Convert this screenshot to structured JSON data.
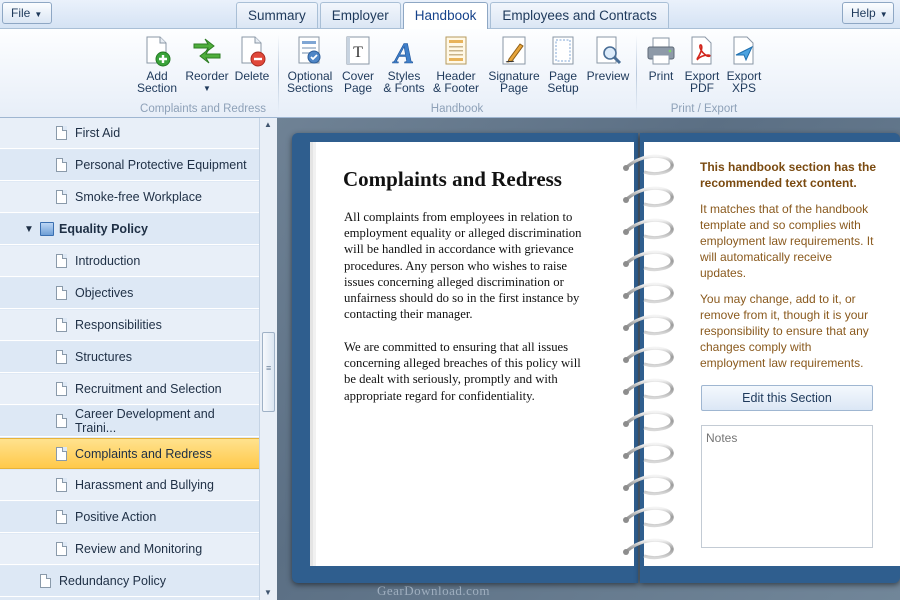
{
  "menu": {
    "file": "File",
    "help": "Help"
  },
  "tabs": [
    "Summary",
    "Employer",
    "Handbook",
    "Employees and Contracts"
  ],
  "ribbon": {
    "groups": [
      {
        "label": "Complaints and Redress",
        "buttons": [
          {
            "line1": "Add",
            "line2": "Section",
            "icon": "add-document-icon"
          },
          {
            "line1": "Reorder",
            "line2": "",
            "icon": "reorder-arrows-icon"
          },
          {
            "line1": "Delete",
            "line2": "",
            "icon": "delete-document-icon"
          }
        ]
      },
      {
        "label": "Handbook",
        "buttons": [
          {
            "line1": "Optional",
            "line2": "Sections",
            "icon": "optional-sections-icon"
          },
          {
            "line1": "Cover",
            "line2": "Page",
            "icon": "cover-page-icon"
          },
          {
            "line1": "Styles",
            "line2": "& Fonts",
            "icon": "styles-fonts-icon"
          },
          {
            "line1": "Header",
            "line2": "& Footer",
            "icon": "header-footer-icon"
          },
          {
            "line1": "Signature",
            "line2": "Page",
            "icon": "signature-pen-icon"
          },
          {
            "line1": "Page",
            "line2": "Setup",
            "icon": "page-setup-icon"
          },
          {
            "line1": "Preview",
            "line2": "",
            "icon": "preview-magnifier-icon"
          }
        ]
      },
      {
        "label": "Print / Export",
        "buttons": [
          {
            "line1": "Print",
            "line2": "",
            "icon": "printer-icon"
          },
          {
            "line1": "Export",
            "line2": "PDF",
            "icon": "pdf-icon"
          },
          {
            "line1": "Export",
            "line2": "XPS",
            "icon": "xps-icon"
          }
        ]
      }
    ]
  },
  "tree": [
    {
      "label": "First Aid",
      "level": 2
    },
    {
      "label": "Personal Protective Equipment",
      "level": 2
    },
    {
      "label": "Smoke-free Workplace",
      "level": 2
    },
    {
      "label": "Equality Policy",
      "level": 1,
      "expanded": true,
      "folder": true
    },
    {
      "label": "Introduction",
      "level": 2
    },
    {
      "label": "Objectives",
      "level": 2
    },
    {
      "label": "Responsibilities",
      "level": 2
    },
    {
      "label": "Structures",
      "level": 2
    },
    {
      "label": "Recruitment and Selection",
      "level": 2
    },
    {
      "label": "Career Development and Traini...",
      "level": 2
    },
    {
      "label": "Complaints and Redress",
      "level": 2,
      "selected": true
    },
    {
      "label": "Harassment and Bullying",
      "level": 2
    },
    {
      "label": "Positive Action",
      "level": 2
    },
    {
      "label": "Review and Monitoring",
      "level": 2
    },
    {
      "label": "Redundancy Policy",
      "level": 1
    }
  ],
  "document": {
    "title": "Complaints and Redress",
    "paragraphs": [
      "All complaints from employees in relation to employment equality or alleged discrimination will be handled in accordance with grievance procedures. Any person who wishes to raise issues concerning alleged discrimination or unfairness should do so in the first instance by contacting their manager.",
      "We are committed to ensuring that all issues concerning alleged breaches of this policy will be dealt with seriously, promptly and with appropriate regard for confidentiality."
    ]
  },
  "info": {
    "heading": "This handbook section has the recommended text content.",
    "para1": "It matches that of the handbook template and so complies with employment law requirements. It will automatically receive updates.",
    "para2": "You may change, add to it, or remove from it, though it is your responsibility to ensure that any changes comply with employment law requirements.",
    "edit_button": "Edit this Section",
    "notes_placeholder": "Notes"
  },
  "watermark": "GearDownload.com",
  "colors": {
    "accent": "#15428b",
    "selected_row": "#ffc94a",
    "book_cover": "#2f5e8e",
    "info_text": "#8a5a1e"
  }
}
